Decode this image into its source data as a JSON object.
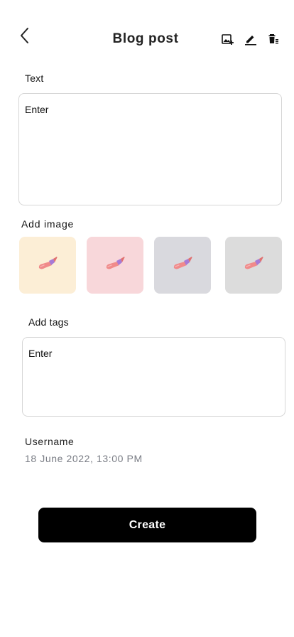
{
  "header": {
    "title": "Blog post",
    "icons": [
      "arrow-back-icon",
      "add-image-icon",
      "edit-icon",
      "delete-icon"
    ]
  },
  "text_section": {
    "label": "Text",
    "value": "Enter"
  },
  "image_section": {
    "label": "Add image",
    "tiles": [
      {
        "icon": "brush-icon",
        "color": "#FCEED6"
      },
      {
        "icon": "brush-icon",
        "color": "#F8D7DA"
      },
      {
        "icon": "brush-icon",
        "color": "#D9D9DE"
      },
      {
        "icon": "brush-icon",
        "color": "#DCDCDC"
      }
    ]
  },
  "tags_section": {
    "label": "Add tags",
    "value": "Enter"
  },
  "meta": {
    "username": "Username",
    "date": "18 June 2022, 13:00 PM"
  },
  "actions": {
    "create_label": "Create"
  },
  "colors": {
    "primary_button": "#000000",
    "border": "#D6D6D6",
    "muted_text": "#7A7D85"
  }
}
